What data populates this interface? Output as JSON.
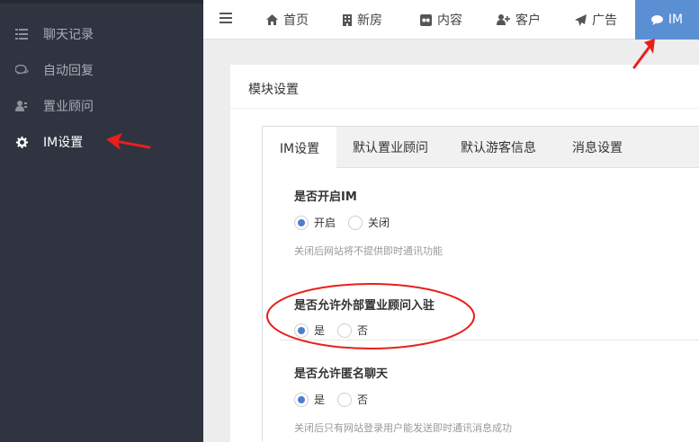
{
  "sidebar": {
    "items": [
      {
        "label": "聊天记录",
        "icon": "list-icon"
      },
      {
        "label": "自动回复",
        "icon": "comments-icon"
      },
      {
        "label": "置业顾问",
        "icon": "users-icon"
      },
      {
        "label": "IM设置",
        "icon": "gear-icon",
        "active": true
      }
    ]
  },
  "topnav": {
    "items": [
      {
        "label": "首页",
        "icon": "home-icon"
      },
      {
        "label": "新房",
        "icon": "building-icon"
      },
      {
        "label": "内容",
        "icon": "flickr-icon"
      },
      {
        "label": "客户",
        "icon": "user-plus-icon"
      },
      {
        "label": "广告",
        "icon": "paper-plane-icon"
      },
      {
        "label": "IM",
        "icon": "comment-icon",
        "active": true
      }
    ]
  },
  "panel": {
    "title": "模块设置",
    "tabs": [
      {
        "label": "IM设置",
        "active": true
      },
      {
        "label": "默认置业顾问"
      },
      {
        "label": "默认游客信息"
      },
      {
        "label": "消息设置"
      }
    ],
    "fields": [
      {
        "label": "是否开启IM",
        "options": [
          {
            "label": "开启",
            "checked": true
          },
          {
            "label": "关闭",
            "checked": false
          }
        ],
        "help": "关闭后网站将不提供即时通讯功能"
      },
      {
        "label": "是否允许外部置业顾问入驻",
        "options": [
          {
            "label": "是",
            "checked": true
          },
          {
            "label": "否",
            "checked": false
          }
        ],
        "help": ""
      },
      {
        "label": "是否允许匿名聊天",
        "options": [
          {
            "label": "是",
            "checked": true
          },
          {
            "label": "否",
            "checked": false
          }
        ],
        "help": "关闭后只有网站登录用户能发送即时通讯消息成功"
      }
    ]
  },
  "colors": {
    "sidebar_bg": "#2f3440",
    "nav_active_bg": "#5b8fd4",
    "radio_checked": "#4a7fd0",
    "annotation_red": "#e8201a"
  }
}
